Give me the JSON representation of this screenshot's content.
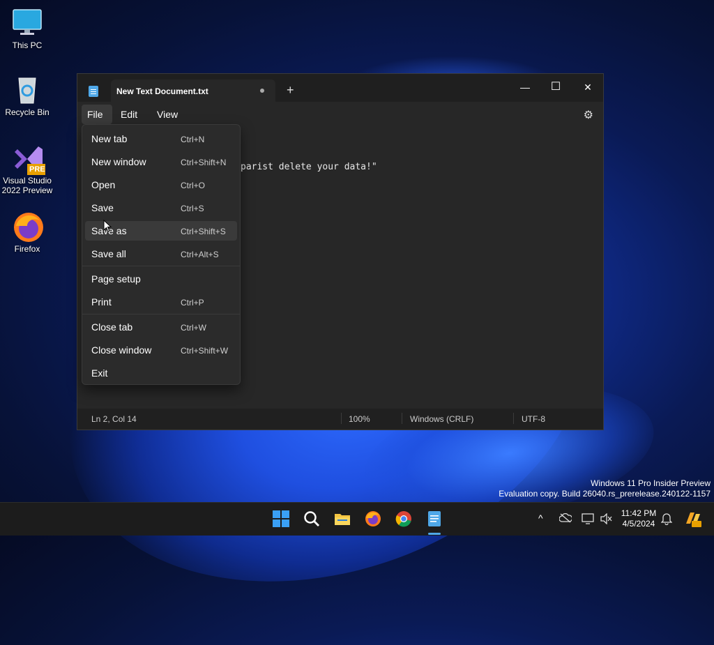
{
  "desktop": {
    "icons": [
      {
        "label": "This PC"
      },
      {
        "label": "Recycle Bin"
      },
      {
        "label_line1": "Visual Studio",
        "label_line2": "2022 Preview",
        "badge": "PRE"
      },
      {
        "label": "Firefox"
      }
    ],
    "watermark_line1": "Windows 11 Pro Insider Preview",
    "watermark_line2": "Evaluation copy. Build 26040.rs_prerelease.240122-1157"
  },
  "window": {
    "tab_title": "New Text Document.txt",
    "new_tab_glyph": "+",
    "minimize_glyph": "—",
    "maximize_glyph": "☐",
    "close_glyph": "✕",
    "menus": [
      "File",
      "Edit",
      "View"
    ],
    "settings_icon": "gear-icon",
    "editor_visible_text": "parist delete your data!\"",
    "status": {
      "position": "Ln 2, Col 14",
      "zoom": "100%",
      "line_ending": "Windows (CRLF)",
      "encoding": "UTF-8"
    }
  },
  "file_menu": {
    "items": [
      {
        "label": "New tab",
        "shortcut": "Ctrl+N"
      },
      {
        "label": "New window",
        "shortcut": "Ctrl+Shift+N"
      },
      {
        "label": "Open",
        "shortcut": "Ctrl+O"
      },
      {
        "label": "Save",
        "shortcut": "Ctrl+S"
      },
      {
        "label": "Save as",
        "shortcut": "Ctrl+Shift+S"
      },
      {
        "label": "Save all",
        "shortcut": "Ctrl+Alt+S"
      },
      {
        "label": "Page setup",
        "shortcut": ""
      },
      {
        "label": "Print",
        "shortcut": "Ctrl+P"
      },
      {
        "label": "Close tab",
        "shortcut": "Ctrl+W"
      },
      {
        "label": "Close window",
        "shortcut": "Ctrl+Shift+W"
      },
      {
        "label": "Exit",
        "shortcut": ""
      }
    ],
    "hovered": "Save as"
  },
  "taskbar": {
    "apps": [
      "start-icon",
      "search-icon",
      "file-explorer-icon",
      "firefox-icon",
      "chrome-icon",
      "notepad-icon"
    ],
    "tray_chevron": "^",
    "time": "11:42 PM",
    "date": "4/5/2024"
  }
}
